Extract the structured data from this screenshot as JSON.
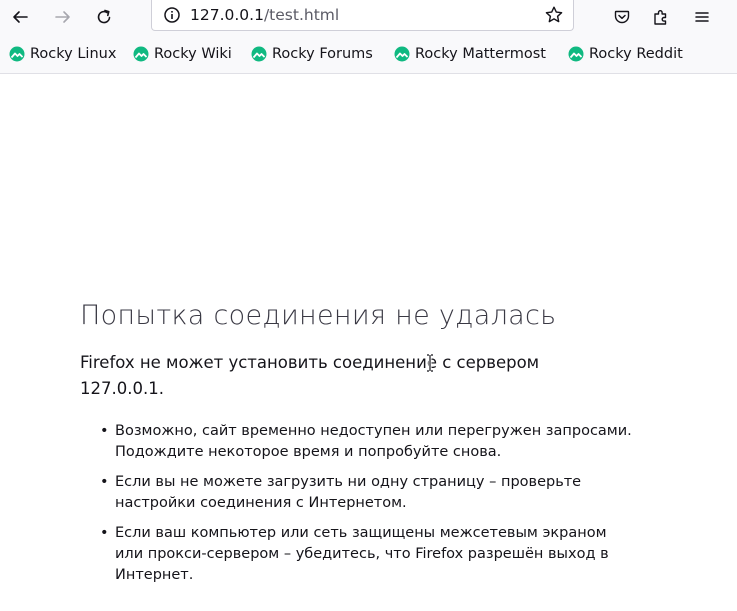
{
  "browser": {
    "url_host": "127.0.0.1",
    "url_path": "/test.html",
    "bookmarks": [
      {
        "label": "Rocky Linux"
      },
      {
        "label": "Rocky Wiki"
      },
      {
        "label": "Rocky Forums"
      },
      {
        "label": "Rocky Mattermost"
      },
      {
        "label": "Rocky Reddit"
      }
    ],
    "icons": {
      "back": "arrow-left-icon",
      "forward": "arrow-right-icon",
      "reload": "reload-icon",
      "site_info": "info-icon",
      "bookmark_star": "star-icon",
      "pocket": "pocket-icon",
      "extensions": "puzzle-icon",
      "menu": "hamburger-menu-icon",
      "bookmark_favicon": "rocky-logo-icon"
    },
    "colors": {
      "rocky_green": "#10b981"
    }
  },
  "error_page": {
    "title": "Попытка соединения не удалась",
    "intro": "Firefox не может установить соединение с сервером 127.0.0.1.",
    "tips": [
      "Возможно, сайт временно недоступен или перегружен запросами. Подождите некоторое время и попробуйте снова.",
      "Если вы не можете загрузить ни одну страницу – проверьте настройки соединения с Интернетом.",
      "Если ваш компьютер или сеть защищены межсетевым экраном или прокси-сервером – убедитесь, что Firefox разрешён выход в Интернет."
    ]
  }
}
